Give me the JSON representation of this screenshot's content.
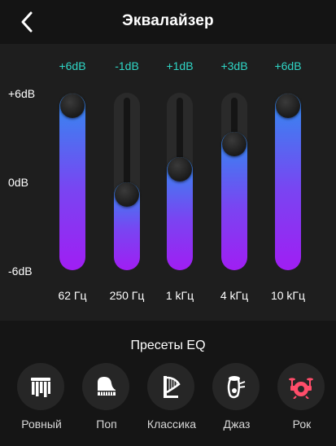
{
  "header": {
    "title": "Эквалайзер"
  },
  "db_axis": {
    "top": "+6dB",
    "middle": "0dB",
    "bottom": "-6dB"
  },
  "bands": [
    {
      "freq": "62 Гц",
      "value_label": "+6dB",
      "gain_db": 6
    },
    {
      "freq": "250 Гц",
      "value_label": "-1dB",
      "gain_db": -1
    },
    {
      "freq": "1 kГц",
      "value_label": "+1dB",
      "gain_db": 1
    },
    {
      "freq": "4 kГц",
      "value_label": "+3dB",
      "gain_db": 3
    },
    {
      "freq": "10 kГц",
      "value_label": "+6dB",
      "gain_db": 6
    }
  ],
  "presets": {
    "title": "Пресеты EQ",
    "items": [
      {
        "label": "Ровный",
        "icon": "flat-preset-icon",
        "color": "#ffffff"
      },
      {
        "label": "Поп",
        "icon": "piano-icon",
        "color": "#ffffff"
      },
      {
        "label": "Классика",
        "icon": "harp-icon",
        "color": "#ffffff"
      },
      {
        "label": "Джаз",
        "icon": "tuba-icon",
        "color": "#ffffff"
      },
      {
        "label": "Рок",
        "icon": "drums-icon",
        "color": "#ff4d6a"
      }
    ]
  },
  "colors": {
    "value_text": "#2fd6c6",
    "fill_top": "#2f8ef0",
    "fill_bottom": "#a01ef3"
  }
}
